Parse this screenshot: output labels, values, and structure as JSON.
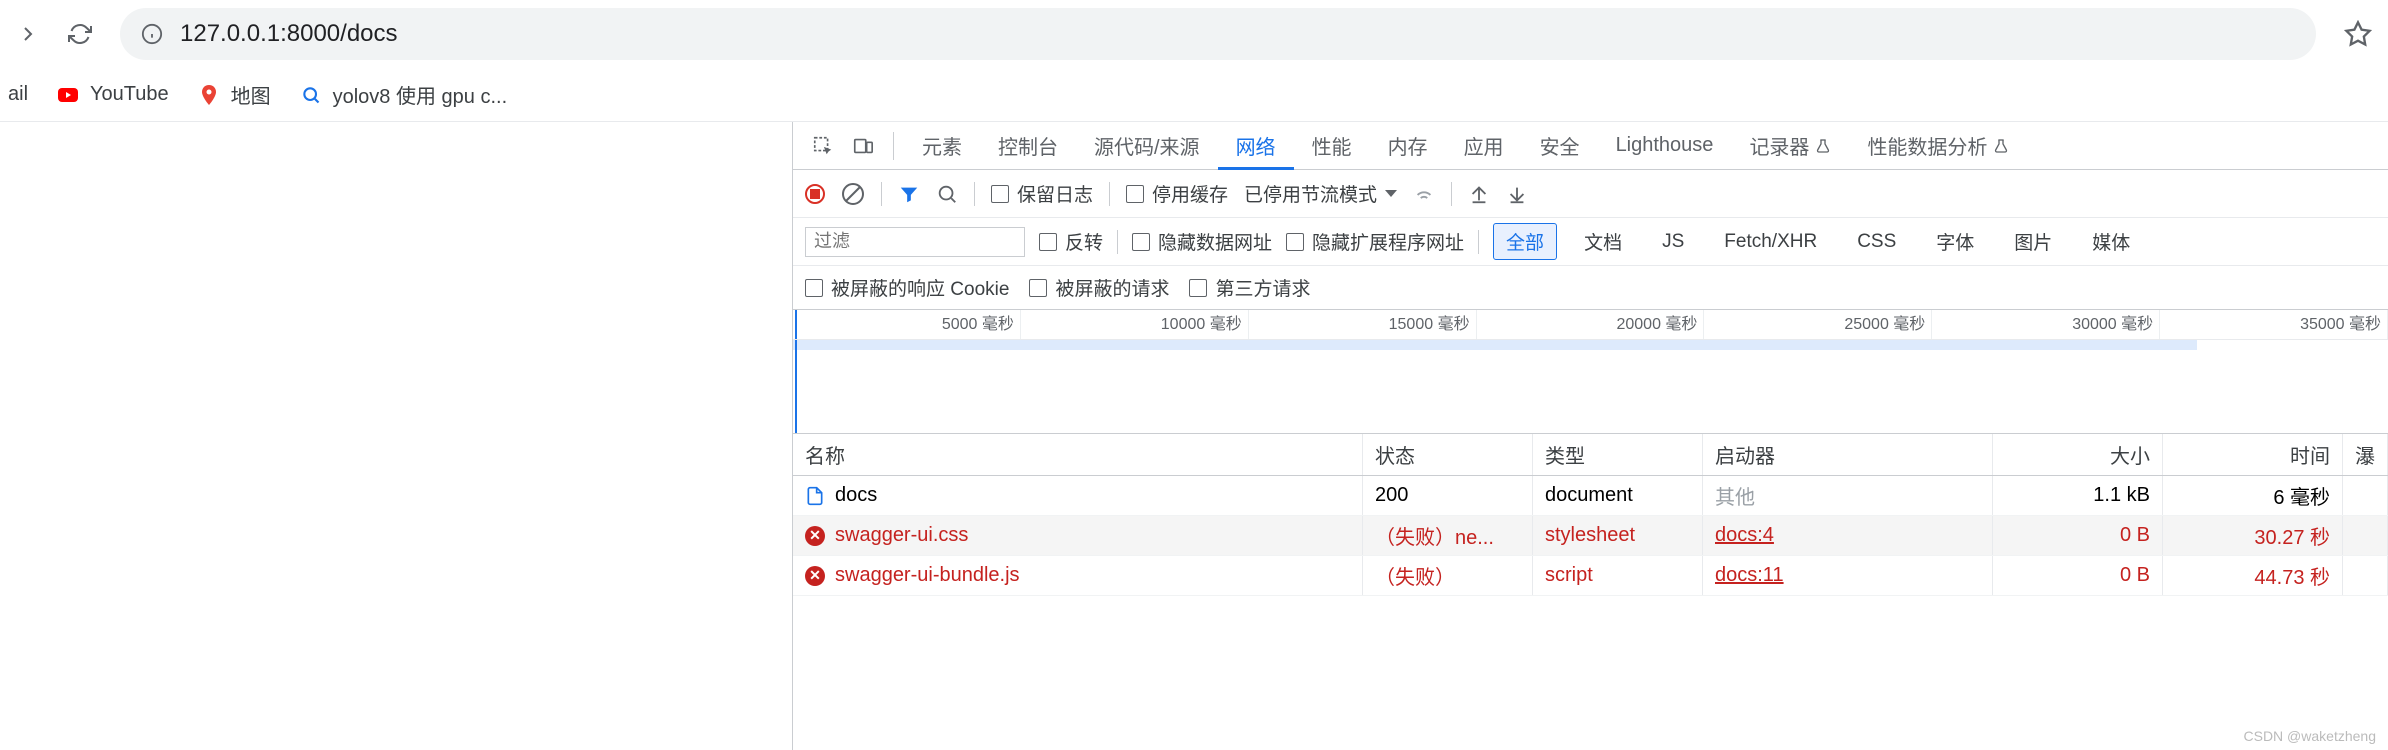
{
  "browser": {
    "url": "127.0.0.1:8000/docs"
  },
  "bookmarks": {
    "gmail_partial": "ail",
    "youtube": "YouTube",
    "maps": "地图",
    "search_text": "yolov8 使用 gpu c..."
  },
  "devtools": {
    "tabs": {
      "elements": "元素",
      "console": "控制台",
      "sources": "源代码/来源",
      "network": "网络",
      "performance": "性能",
      "memory": "内存",
      "application": "应用",
      "security": "安全",
      "lighthouse": "Lighthouse",
      "recorder": "记录器",
      "perf_insights": "性能数据分析"
    },
    "toolbar": {
      "preserve_log": "保留日志",
      "disable_cache": "停用缓存",
      "throttling": "已停用节流模式"
    },
    "filters": {
      "placeholder": "过滤",
      "invert": "反转",
      "hide_data_urls": "隐藏数据网址",
      "hide_ext_urls": "隐藏扩展程序网址",
      "all": "全部",
      "doc": "文档",
      "js": "JS",
      "fetch": "Fetch/XHR",
      "css": "CSS",
      "font": "字体",
      "img": "图片",
      "media": "媒体"
    },
    "filters3": {
      "blocked_cookies": "被屏蔽的响应 Cookie",
      "blocked_requests": "被屏蔽的请求",
      "third_party": "第三方请求"
    },
    "timeline": {
      "ticks": [
        "5000 毫秒",
        "10000 毫秒",
        "15000 毫秒",
        "20000 毫秒",
        "25000 毫秒",
        "30000 毫秒",
        "35000 毫秒"
      ]
    },
    "table": {
      "headers": {
        "name": "名称",
        "status": "状态",
        "type": "类型",
        "initiator": "启动器",
        "size": "大小",
        "time": "时间",
        "waterfall": "瀑"
      },
      "rows": [
        {
          "name": "docs",
          "status": "200",
          "type": "document",
          "initiator": "其他",
          "initiator_gray": true,
          "size": "1.1 kB",
          "time": "6 毫秒",
          "failed": false,
          "icon": "doc"
        },
        {
          "name": "swagger-ui.css",
          "status": "（失败）ne...",
          "type": "stylesheet",
          "initiator": "docs:4",
          "size": "0 B",
          "time": "30.27 秒",
          "failed": true,
          "alt": true,
          "icon": "err"
        },
        {
          "name": "swagger-ui-bundle.js",
          "status": "（失败）",
          "type": "script",
          "initiator": "docs:11",
          "size": "0 B",
          "time": "44.73 秒",
          "failed": true,
          "icon": "err"
        }
      ]
    }
  },
  "watermark": "CSDN @waketzheng"
}
